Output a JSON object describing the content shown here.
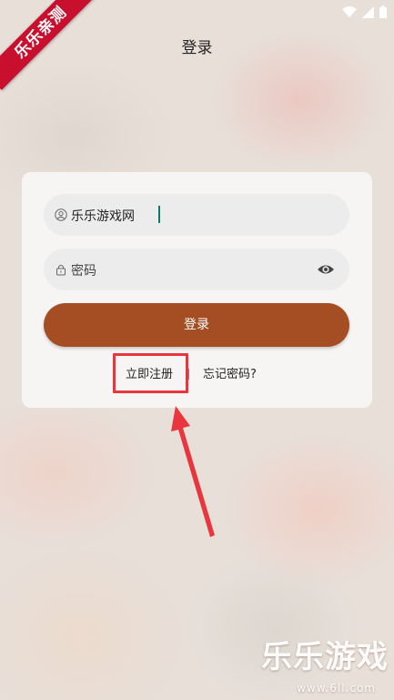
{
  "status_bar": {
    "icons": [
      "wifi-icon",
      "signal-icon",
      "battery-icon"
    ]
  },
  "ribbon": {
    "text": "乐乐亲测"
  },
  "header": {
    "title": "登录"
  },
  "form": {
    "username": {
      "value": "乐乐游戏网",
      "icon": "user-icon"
    },
    "password": {
      "placeholder": "密码",
      "icon": "lock-icon",
      "toggle_icon": "eye-icon"
    },
    "login_label": "登录",
    "register_label": "立即注册",
    "forgot_label": "忘记密码?"
  },
  "annotation": {
    "color": "#e9353d",
    "target": "register-link"
  },
  "colors": {
    "accent": "#a54d23",
    "ribbon": "#c8102e"
  },
  "watermark": {
    "text": "乐乐游戏",
    "url": "www.6ll.com"
  }
}
